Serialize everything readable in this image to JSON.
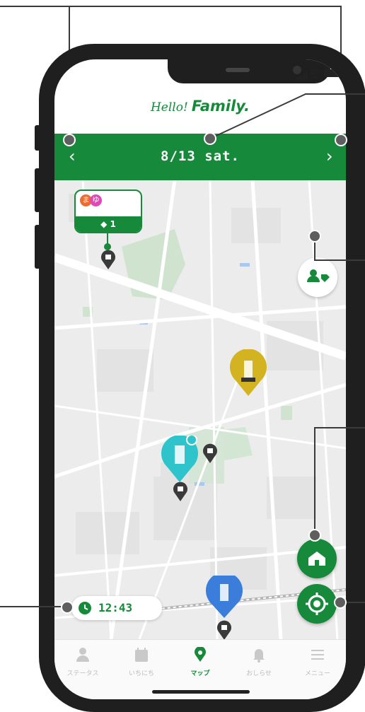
{
  "colors": {
    "brand_green": "#168a3a",
    "map_bg": "#ececec",
    "char_yellow": "#d4b322",
    "char_cyan": "#2fc4cc",
    "char_blue": "#3a7ddb"
  },
  "app": {
    "logo_script": "Hello!",
    "logo_bold": "Family."
  },
  "status_bar": {
    "signal_icon": "signal-icon",
    "wifi_icon": "wifi-icon",
    "battery_icon": "battery-icon"
  },
  "date_bar": {
    "date": "8/13 sat.",
    "prev_icon": "chevron-left-icon",
    "next_icon": "chevron-right-icon"
  },
  "family_card": {
    "member_1": "ま",
    "member_2": "ゆ",
    "tag_count": "1"
  },
  "time_chip": {
    "time": "12:43",
    "icon": "clock-icon"
  },
  "fabs": {
    "member_tag": "member-tag-icon",
    "home": "home-icon",
    "locate": "locate-icon"
  },
  "tabs": [
    {
      "label": "ステータス",
      "icon": "person-icon",
      "active": false
    },
    {
      "label": "いちにち",
      "icon": "calendar-icon",
      "active": false
    },
    {
      "label": "マップ",
      "icon": "map-pin-icon",
      "active": true
    },
    {
      "label": "おしらせ",
      "icon": "bell-icon",
      "active": false
    },
    {
      "label": "メニュー",
      "icon": "menu-icon",
      "active": false
    }
  ]
}
